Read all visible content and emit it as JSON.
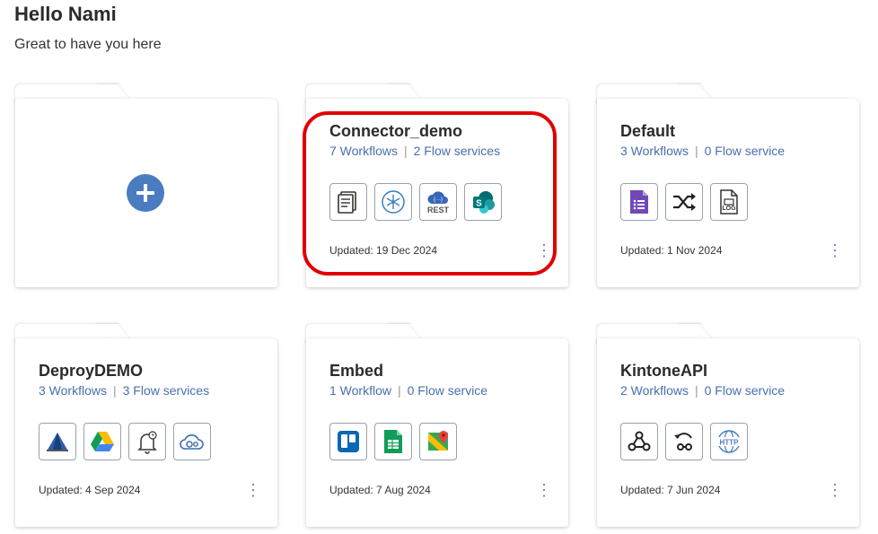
{
  "header": {
    "greeting": "Hello Nami",
    "subtitle": "Great to have you here"
  },
  "cards": [
    {
      "name": "Connector_demo",
      "workflows": "7 Workflows",
      "flows": "2 Flow services",
      "updated": "Updated: 19 Dec 2024",
      "icons": [
        "document-icon",
        "dynamics-icon",
        "rest-api-icon",
        "sharepoint-icon"
      ]
    },
    {
      "name": "Default",
      "workflows": "3 Workflows",
      "flows": "0 Flow service",
      "updated": "Updated: 1 Nov 2024",
      "icons": [
        "google-forms-icon",
        "shuffle-icon",
        "log-file-icon"
      ]
    },
    {
      "name": "DeproyDEMO",
      "workflows": "3 Workflows",
      "flows": "3 Flow services",
      "updated": "Updated: 4 Sep 2024",
      "icons": [
        "tent-icon",
        "google-drive-icon",
        "alarm-bell-icon",
        "cloud-gear-icon"
      ]
    },
    {
      "name": "Embed",
      "workflows": "1 Workflow",
      "flows": "0 Flow service",
      "updated": "Updated: 7 Aug 2024",
      "icons": [
        "trello-icon",
        "google-sheets-icon",
        "google-maps-icon"
      ]
    },
    {
      "name": "KintoneAPI",
      "workflows": "2 Workflows",
      "flows": "0 Flow service",
      "updated": "Updated: 7 Jun 2024",
      "icons": [
        "webhook-icon",
        "webhook-return-icon",
        "http-globe-icon"
      ]
    }
  ],
  "icon_labels": {
    "rest": "REST",
    "log": "LOG",
    "http": "HTTP"
  },
  "colors": {
    "accent": "#4a7cc2",
    "link": "#4a6fb0",
    "highlight": "#e00000"
  }
}
